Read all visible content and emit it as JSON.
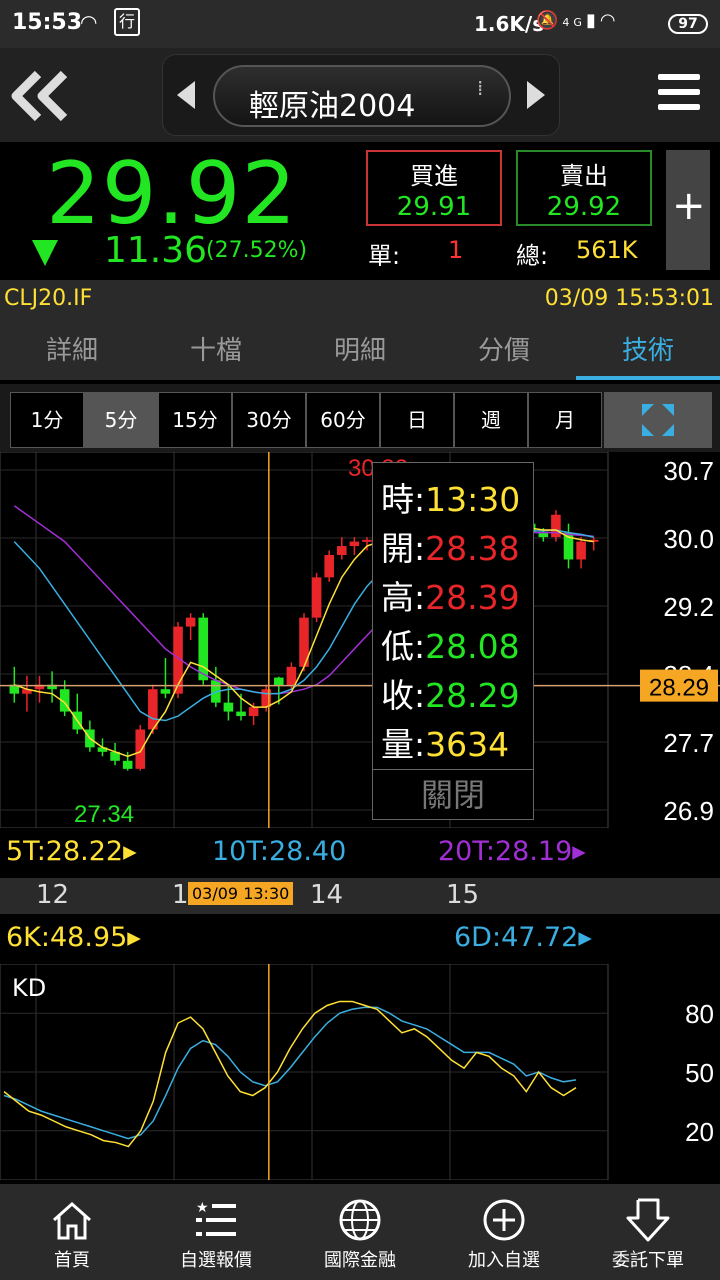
{
  "status_bar": {
    "time": "15:53",
    "network_speed": "1.6K/s",
    "network_type": "4G",
    "battery": "97"
  },
  "header": {
    "title": "輕原油2004"
  },
  "quote": {
    "price": "29.92",
    "change": "11.36",
    "change_pct": "(27.52%)",
    "bid_label": "買進",
    "bid": "29.91",
    "ask_label": "賣出",
    "ask": "29.92",
    "unit_label": "單:",
    "unit": "1",
    "total_label": "總:",
    "total": "561K"
  },
  "code_row": {
    "code": "CLJ20.IF",
    "datetime": "03/09 15:53:01"
  },
  "tabs": [
    {
      "label": "詳細"
    },
    {
      "label": "十檔"
    },
    {
      "label": "明細"
    },
    {
      "label": "分價"
    },
    {
      "label": "技術"
    }
  ],
  "active_tab": "技術",
  "periods": [
    "1分",
    "5分",
    "15分",
    "30分",
    "60分",
    "日",
    "週",
    "月"
  ],
  "selected_period": "5分",
  "main_chart": {
    "y_ticks": [
      "30.7",
      "30.0",
      "29.2",
      "28.4",
      "27.7",
      "26.9"
    ],
    "current_price_tag": "28.29",
    "high_label": "30.32",
    "low_label": "27.34",
    "ma_legend": {
      "ma5": "5T:28.22",
      "ma10": "10T:28.40",
      "ma20": "20T:28.19"
    }
  },
  "time_axis": {
    "labels": [
      "12",
      "1",
      "14",
      "15"
    ],
    "cursor_label": "03/09 13:30"
  },
  "tooltip": {
    "time_label": "時:",
    "time": "13:30",
    "open_label": "開:",
    "open": "28.38",
    "high_label": "高:",
    "high": "28.39",
    "low_label": "低:",
    "low": "28.08",
    "close_label": "收:",
    "close": "28.29",
    "volume_label": "量:",
    "volume": "3634",
    "close_button": "關閉"
  },
  "kd": {
    "k_legend": "6K:48.95",
    "d_legend": "6D:47.72",
    "title": "KD",
    "y_ticks": [
      "80",
      "50",
      "20"
    ]
  },
  "bottom_nav": [
    {
      "label": "首頁",
      "icon": "home-icon"
    },
    {
      "label": "自選報價",
      "icon": "watchlist-icon"
    },
    {
      "label": "國際金融",
      "icon": "globe-icon"
    },
    {
      "label": "加入自選",
      "icon": "add-circle-icon"
    },
    {
      "label": "委託下單",
      "icon": "order-arrow-icon"
    }
  ],
  "colors": {
    "up": "#e8262a",
    "down": "#22e622",
    "accent": "#3aaee0",
    "highlight": "#ffe135",
    "ma20": "#a22fd6",
    "tag": "#f5a623"
  },
  "chart_data": {
    "type": "candlestick",
    "ylim": [
      26.9,
      30.7
    ],
    "candles": [
      {
        "o": 28.3,
        "h": 28.5,
        "l": 28.1,
        "c": 28.2
      },
      {
        "o": 28.2,
        "h": 28.4,
        "l": 28.0,
        "c": 28.25
      },
      {
        "o": 28.25,
        "h": 28.4,
        "l": 28.1,
        "c": 28.3
      },
      {
        "o": 28.3,
        "h": 28.45,
        "l": 28.1,
        "c": 28.25
      },
      {
        "o": 28.25,
        "h": 28.35,
        "l": 27.95,
        "c": 28.0
      },
      {
        "o": 28.0,
        "h": 28.2,
        "l": 27.75,
        "c": 27.8
      },
      {
        "o": 27.8,
        "h": 27.9,
        "l": 27.55,
        "c": 27.6
      },
      {
        "o": 27.6,
        "h": 27.7,
        "l": 27.5,
        "c": 27.55
      },
      {
        "o": 27.55,
        "h": 27.65,
        "l": 27.4,
        "c": 27.45
      },
      {
        "o": 27.45,
        "h": 27.55,
        "l": 27.34,
        "c": 27.36
      },
      {
        "o": 27.36,
        "h": 27.85,
        "l": 27.34,
        "c": 27.8
      },
      {
        "o": 27.8,
        "h": 28.3,
        "l": 27.75,
        "c": 28.25
      },
      {
        "o": 28.25,
        "h": 28.6,
        "l": 28.15,
        "c": 28.2
      },
      {
        "o": 28.2,
        "h": 29.0,
        "l": 28.15,
        "c": 28.95
      },
      {
        "o": 28.95,
        "h": 29.1,
        "l": 28.8,
        "c": 29.05
      },
      {
        "o": 29.05,
        "h": 29.1,
        "l": 28.3,
        "c": 28.35
      },
      {
        "o": 28.35,
        "h": 28.5,
        "l": 28.05,
        "c": 28.1
      },
      {
        "o": 28.1,
        "h": 28.3,
        "l": 27.9,
        "c": 28.0
      },
      {
        "o": 28.0,
        "h": 28.2,
        "l": 27.9,
        "c": 27.95
      },
      {
        "o": 27.95,
        "h": 28.1,
        "l": 27.85,
        "c": 28.05
      },
      {
        "o": 28.05,
        "h": 28.3,
        "l": 28.0,
        "c": 28.25
      },
      {
        "o": 28.38,
        "h": 28.39,
        "l": 28.08,
        "c": 28.29
      },
      {
        "o": 28.29,
        "h": 28.55,
        "l": 28.25,
        "c": 28.5
      },
      {
        "o": 28.5,
        "h": 29.1,
        "l": 28.45,
        "c": 29.05
      },
      {
        "o": 29.05,
        "h": 29.55,
        "l": 29.0,
        "c": 29.5
      },
      {
        "o": 29.5,
        "h": 29.8,
        "l": 29.45,
        "c": 29.75
      },
      {
        "o": 29.75,
        "h": 29.95,
        "l": 29.7,
        "c": 29.85
      },
      {
        "o": 29.85,
        "h": 29.95,
        "l": 29.75,
        "c": 29.9
      },
      {
        "o": 29.9,
        "h": 29.95,
        "l": 29.8,
        "c": 29.92
      },
      {
        "o": 29.92,
        "h": 30.0,
        "l": 29.85,
        "c": 29.95
      },
      {
        "o": 29.95,
        "h": 30.05,
        "l": 29.7,
        "c": 29.75
      },
      {
        "o": 29.75,
        "h": 29.85,
        "l": 29.6,
        "c": 29.65
      },
      {
        "o": 29.7,
        "h": 30.1,
        "l": 29.65,
        "c": 30.05
      },
      {
        "o": 30.05,
        "h": 30.32,
        "l": 30.0,
        "c": 30.25
      },
      {
        "o": 30.25,
        "h": 30.3,
        "l": 30.0,
        "c": 30.1
      },
      {
        "o": 30.1,
        "h": 30.2,
        "l": 30.0,
        "c": 30.15
      },
      {
        "o": 30.15,
        "h": 30.25,
        "l": 30.05,
        "c": 30.2
      },
      {
        "o": 30.2,
        "h": 30.25,
        "l": 30.0,
        "c": 30.05
      },
      {
        "o": 30.05,
        "h": 30.15,
        "l": 29.95,
        "c": 30.1
      },
      {
        "o": 30.1,
        "h": 30.15,
        "l": 30.0,
        "c": 30.05
      },
      {
        "o": 30.05,
        "h": 30.15,
        "l": 30.0,
        "c": 30.1
      },
      {
        "o": 30.1,
        "h": 30.2,
        "l": 29.95,
        "c": 30.0
      },
      {
        "o": 30.0,
        "h": 30.05,
        "l": 29.9,
        "c": 29.95
      },
      {
        "o": 29.95,
        "h": 30.25,
        "l": 29.9,
        "c": 30.2
      },
      {
        "o": 30.0,
        "h": 30.1,
        "l": 29.6,
        "c": 29.7
      },
      {
        "o": 29.7,
        "h": 29.95,
        "l": 29.6,
        "c": 29.9
      },
      {
        "o": 29.9,
        "h": 29.95,
        "l": 29.8,
        "c": 29.92
      }
    ],
    "ma5": [
      28.3,
      28.25,
      28.22,
      28.2,
      28.1,
      27.9,
      27.7,
      27.6,
      27.55,
      27.5,
      27.55,
      27.8,
      28.0,
      28.3,
      28.55,
      28.5,
      28.4,
      28.3,
      28.15,
      28.05,
      28.05,
      28.12,
      28.22,
      28.5,
      28.85,
      29.2,
      29.5,
      29.7,
      29.85,
      29.9,
      29.88,
      29.85,
      29.9,
      29.95,
      30.0,
      30.05,
      30.1,
      30.12,
      30.1,
      30.08,
      30.07,
      30.05,
      30.03,
      30.03,
      29.95,
      29.92,
      29.9
    ],
    "ma10": [
      29.9,
      29.75,
      29.6,
      29.4,
      29.2,
      29.0,
      28.8,
      28.6,
      28.4,
      28.2,
      28.0,
      27.92,
      27.9,
      27.95,
      28.05,
      28.15,
      28.22,
      28.25,
      28.25,
      28.22,
      28.2,
      28.2,
      28.25,
      28.35,
      28.5,
      28.7,
      28.95,
      29.2,
      29.4,
      29.55,
      29.65,
      29.75,
      29.82,
      29.88,
      29.92,
      29.96,
      30.0,
      30.02,
      30.02,
      30.02,
      30.02,
      30.02,
      30.02,
      30.03,
      30.0,
      29.98,
      29.95
    ],
    "ma20": [
      30.3,
      30.2,
      30.1,
      30.0,
      29.9,
      29.75,
      29.6,
      29.45,
      29.3,
      29.15,
      29.0,
      28.85,
      28.7,
      28.6,
      28.5,
      28.42,
      28.35,
      28.3,
      28.25,
      28.22,
      28.2,
      28.2,
      28.22,
      28.25,
      28.3,
      28.4,
      28.55,
      28.7,
      28.85,
      29.0,
      29.15,
      29.3,
      29.42,
      29.55,
      29.65,
      29.75,
      29.82,
      29.88,
      29.93,
      29.96,
      29.98,
      30.0,
      30.0,
      30.0,
      29.98,
      29.97,
      29.96
    ],
    "kd_k": [
      40,
      35,
      30,
      28,
      25,
      22,
      20,
      18,
      15,
      14,
      12,
      20,
      35,
      60,
      75,
      78,
      72,
      60,
      48,
      40,
      38,
      42,
      50,
      62,
      72,
      80,
      84,
      86,
      86,
      84,
      82,
      76,
      70,
      72,
      68,
      62,
      56,
      52,
      60,
      58,
      52,
      48,
      40,
      50,
      42,
      38,
      42
    ],
    "kd_d": [
      38,
      36,
      33,
      30,
      28,
      26,
      24,
      22,
      20,
      18,
      16,
      18,
      25,
      38,
      52,
      62,
      66,
      64,
      58,
      50,
      45,
      43,
      45,
      52,
      60,
      68,
      75,
      80,
      82,
      83,
      83,
      80,
      76,
      74,
      72,
      68,
      64,
      60,
      60,
      60,
      57,
      54,
      48,
      50,
      47,
      45,
      46
    ]
  }
}
